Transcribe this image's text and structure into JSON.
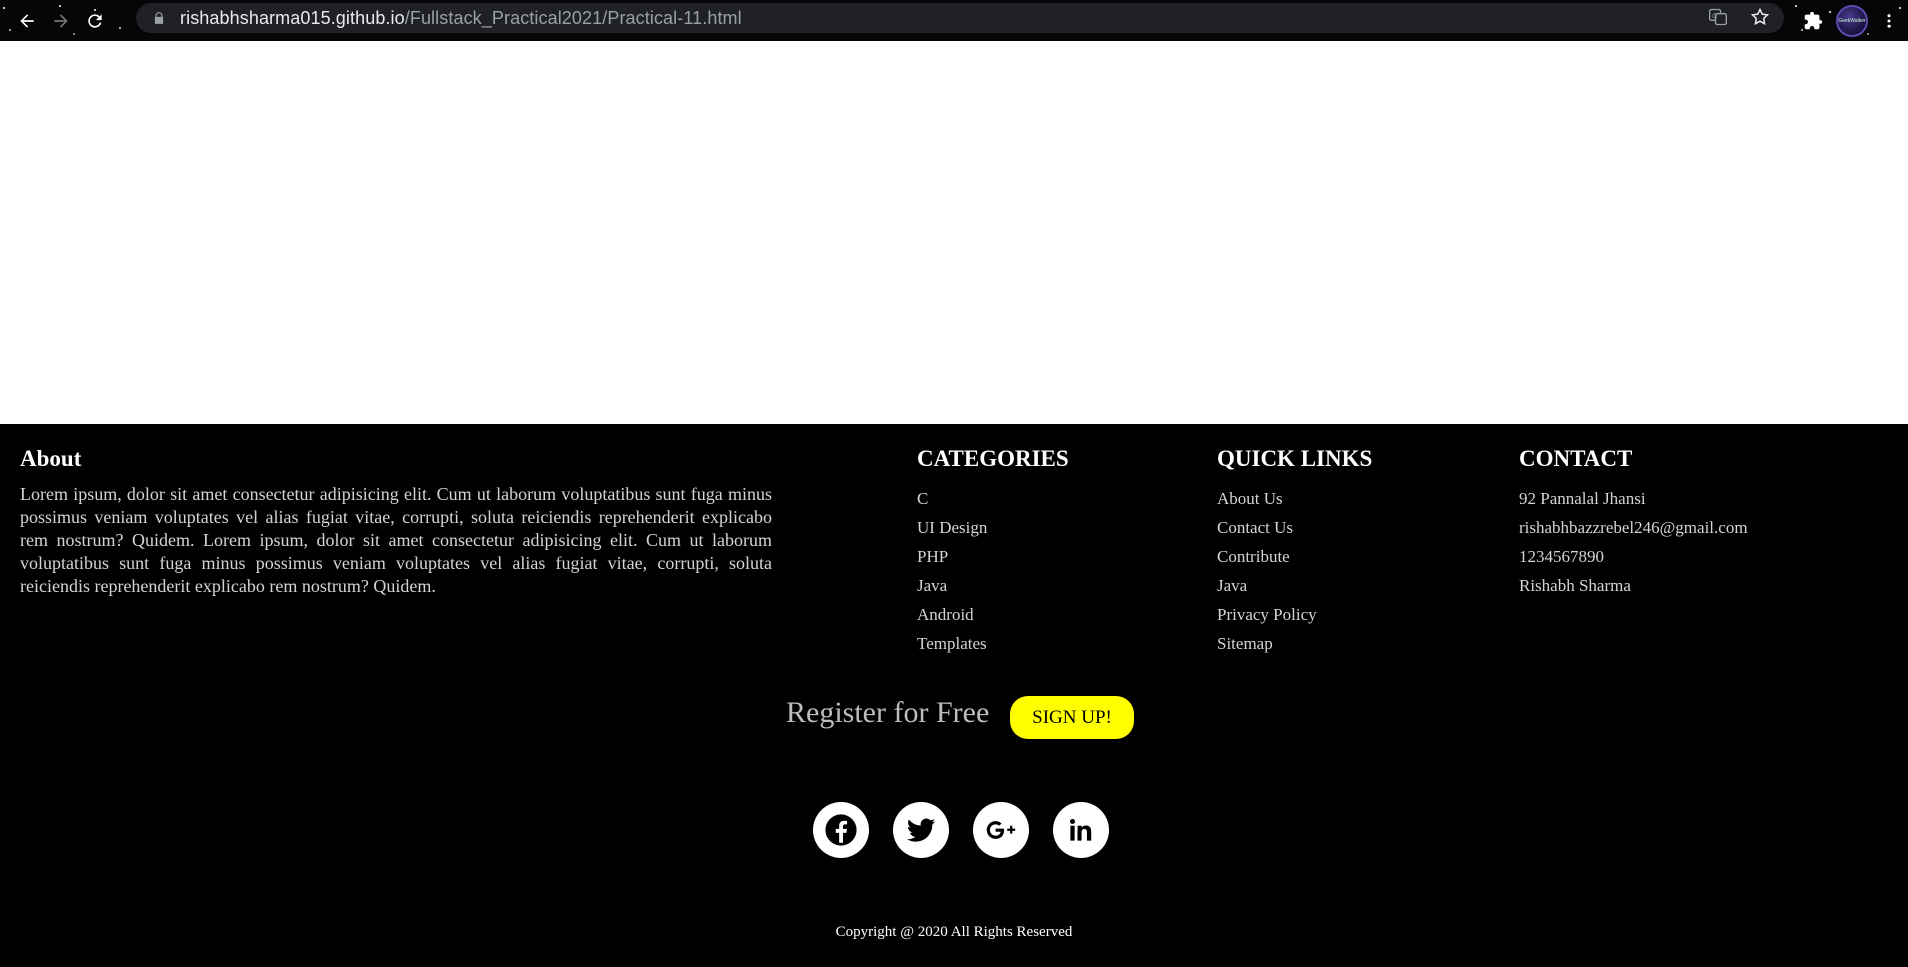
{
  "browser": {
    "url_host": "rishabhsharma015.github.io",
    "url_path": "/Fullstack_Practical2021/Practical-11.html",
    "profile_text": "GeekWalker"
  },
  "footer": {
    "about": {
      "heading": "About",
      "text": "Lorem ipsum, dolor sit amet consectetur adipisicing elit. Cum ut laborum voluptatibus sunt fuga minus possimus veniam voluptates vel alias fugiat vitae, corrupti, soluta reiciendis reprehenderit explicabo rem nostrum? Quidem. Lorem ipsum, dolor sit amet consectetur adipisicing elit. Cum ut laborum voluptatibus sunt fuga minus possimus veniam voluptates vel alias fugiat vitae, corrupti, soluta reiciendis reprehenderit explicabo rem nostrum? Quidem."
    },
    "categories": {
      "heading": "CATEGORIES",
      "items": [
        "C",
        "UI Design",
        "PHP",
        "Java",
        "Android",
        "Templates"
      ]
    },
    "quick_links": {
      "heading": "QUICK LINKS",
      "items": [
        "About Us",
        "Contact Us",
        "Contribute",
        "Java",
        "Privacy Policy",
        "Sitemap"
      ]
    },
    "contact": {
      "heading": "CONTACT",
      "items": [
        "92 Pannalal Jhansi",
        "rishabhbazzrebel246@gmail.com",
        "1234567890",
        "Rishabh Sharma"
      ]
    },
    "register_text": "Register for Free",
    "signup_label": "SIGN UP!",
    "social": [
      "facebook-icon",
      "twitter-icon",
      "google-plus-icon",
      "linkedin-icon"
    ],
    "copyright": "Copyright @ 2020 All Rights Reserved"
  },
  "colors": {
    "signup_bg": "#ffff00",
    "footer_bg": "#000000"
  }
}
